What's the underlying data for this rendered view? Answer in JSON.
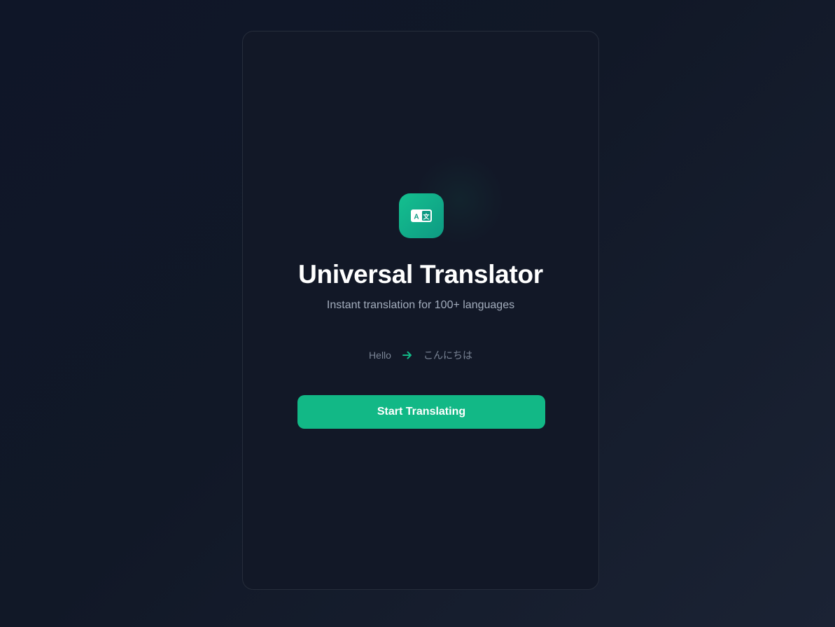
{
  "app": {
    "title": "Universal Translator",
    "subtitle": "Instant translation for 100+ languages"
  },
  "logo": {
    "icon": "translate-icon",
    "glyph_left": "A",
    "glyph_right": "文"
  },
  "demo": {
    "source_text": "Hello",
    "arrow_icon": "arrow-right-icon",
    "target_text": "こんにちは"
  },
  "actions": {
    "start_label": "Start Translating"
  },
  "colors": {
    "accent": "#12b886",
    "background": "#111827",
    "card": "#121827"
  }
}
